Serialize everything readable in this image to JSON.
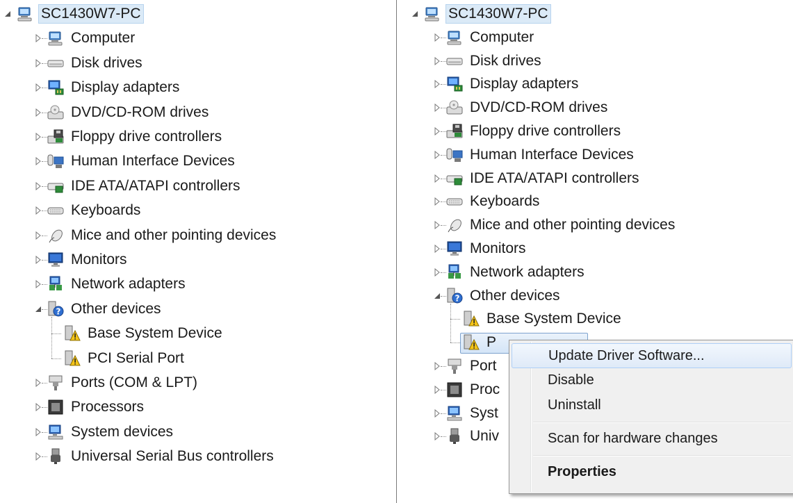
{
  "left": {
    "root": {
      "label": "SC1430W7-PC",
      "icon": "computer-icon"
    },
    "categories": [
      {
        "label": "Computer",
        "icon": "computer-icon"
      },
      {
        "label": "Disk drives",
        "icon": "disk-drive-icon"
      },
      {
        "label": "Display adapters",
        "icon": "display-adapter-icon"
      },
      {
        "label": "DVD/CD-ROM drives",
        "icon": "dvd-drive-icon"
      },
      {
        "label": "Floppy drive controllers",
        "icon": "floppy-controller-icon"
      },
      {
        "label": "Human Interface Devices",
        "icon": "hid-icon"
      },
      {
        "label": "IDE ATA/ATAPI controllers",
        "icon": "ide-controller-icon"
      },
      {
        "label": "Keyboards",
        "icon": "keyboard-icon"
      },
      {
        "label": "Mice and other pointing devices",
        "icon": "mouse-icon"
      },
      {
        "label": "Monitors",
        "icon": "monitor-icon"
      },
      {
        "label": "Network adapters",
        "icon": "network-adapter-icon"
      },
      {
        "label": "Other devices",
        "icon": "unknown-device-icon",
        "expanded": true
      },
      {
        "label": "Base System Device",
        "icon": "warning-device-icon",
        "child": true
      },
      {
        "label": "PCI Serial Port",
        "icon": "warning-device-icon",
        "child": true
      },
      {
        "label": "Ports (COM & LPT)",
        "icon": "port-icon"
      },
      {
        "label": "Processors",
        "icon": "processor-icon"
      },
      {
        "label": "System devices",
        "icon": "system-devices-icon"
      },
      {
        "label": "Universal Serial Bus controllers",
        "icon": "usb-icon"
      }
    ]
  },
  "right": {
    "root": {
      "label": "SC1430W7-PC",
      "icon": "computer-icon"
    },
    "categories": [
      {
        "label": "Computer",
        "icon": "computer-icon"
      },
      {
        "label": "Disk drives",
        "icon": "disk-drive-icon"
      },
      {
        "label": "Display adapters",
        "icon": "display-adapter-icon"
      },
      {
        "label": "DVD/CD-ROM drives",
        "icon": "dvd-drive-icon"
      },
      {
        "label": "Floppy drive controllers",
        "icon": "floppy-controller-icon"
      },
      {
        "label": "Human Interface Devices",
        "icon": "hid-icon"
      },
      {
        "label": "IDE ATA/ATAPI controllers",
        "icon": "ide-controller-icon"
      },
      {
        "label": "Keyboards",
        "icon": "keyboard-icon"
      },
      {
        "label": "Mice and other pointing devices",
        "icon": "mouse-icon"
      },
      {
        "label": "Monitors",
        "icon": "monitor-icon"
      },
      {
        "label": "Network adapters",
        "icon": "network-adapter-icon"
      },
      {
        "label": "Other devices",
        "icon": "unknown-device-icon",
        "expanded": true
      },
      {
        "label": "Base System Device",
        "icon": "warning-device-icon",
        "child": true
      },
      {
        "label": "P",
        "icon": "warning-device-icon",
        "child": true,
        "selected": true
      },
      {
        "label": "Port",
        "icon": "port-icon"
      },
      {
        "label": "Proc",
        "icon": "processor-icon"
      },
      {
        "label": "Syst",
        "icon": "system-devices-icon"
      },
      {
        "label": "Univ",
        "icon": "usb-icon"
      }
    ]
  },
  "context_menu": {
    "items": [
      {
        "label": "Update Driver Software...",
        "highlighted": true
      },
      {
        "label": "Disable"
      },
      {
        "label": "Uninstall"
      },
      {
        "separator": true
      },
      {
        "label": "Scan for hardware changes"
      },
      {
        "separator": true
      },
      {
        "label": "Properties",
        "bold": true
      }
    ]
  },
  "colors": {
    "selection": "#dbeaf7",
    "menu_bg": "#f0f0f0",
    "menu_highlight_border": "#aecff7",
    "divider": "#7a7a7a"
  }
}
